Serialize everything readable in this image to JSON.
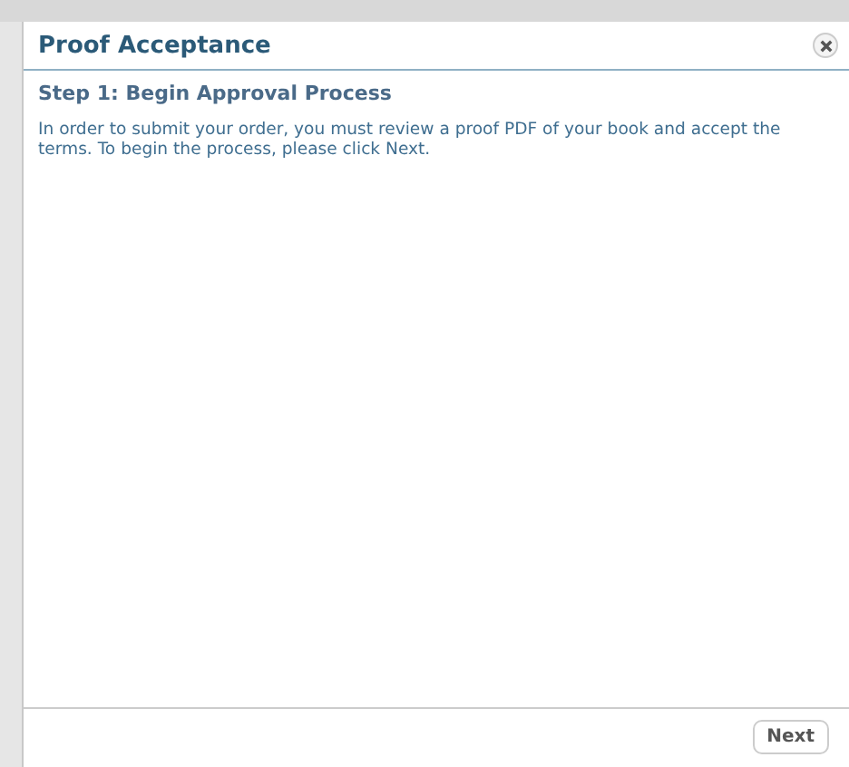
{
  "dialog": {
    "title": "Proof Acceptance",
    "step_title": "Step 1: Begin Approval Process",
    "message": "In order to submit your order, you must review a proof PDF of your book and accept the terms. To begin the process, please click Next.",
    "buttons": [
      "Next"
    ]
  }
}
